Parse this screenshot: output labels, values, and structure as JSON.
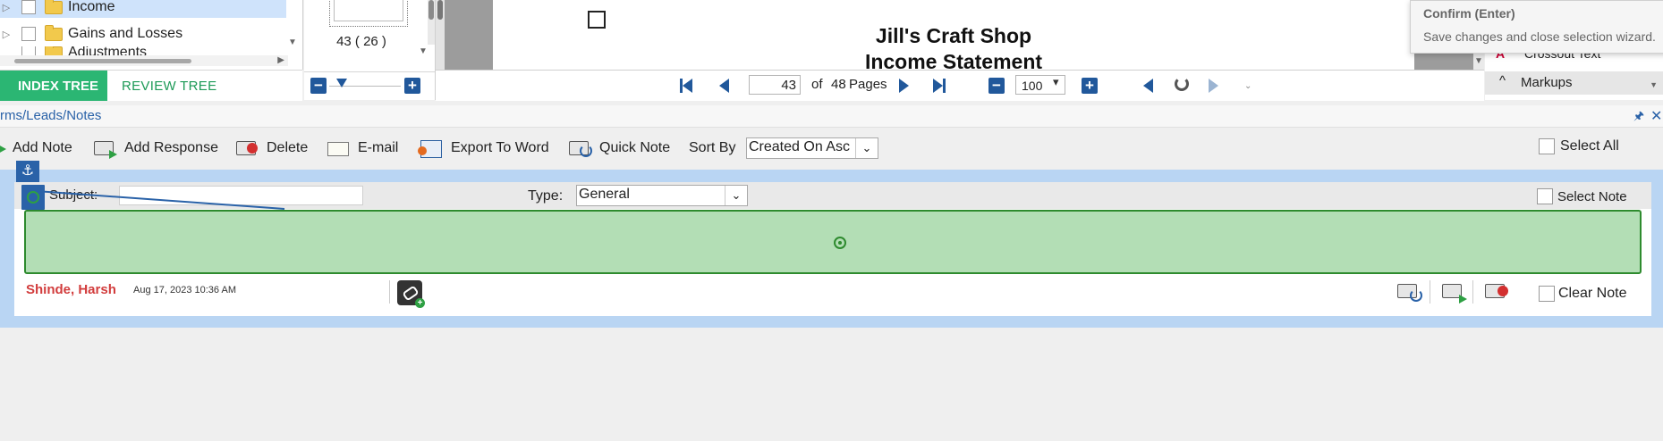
{
  "tree": {
    "items": [
      {
        "label": "Income"
      },
      {
        "label": "Gains and Losses"
      },
      {
        "label": "Adjustments"
      }
    ],
    "tabs": {
      "index": "INDEX TREE",
      "review": "REVIEW TREE"
    }
  },
  "thumbnails": {
    "label": "43 ( 26 )"
  },
  "document": {
    "title_line1": "Jill's Craft Shop",
    "title_line2": "Income Statement"
  },
  "pager": {
    "current_page": "43",
    "of_label": "of",
    "total_pages": "48",
    "pages_label": "Pages",
    "zoom": "100"
  },
  "tooltip": {
    "title": "Confirm (Enter)",
    "text": "Save changes and close selection wizard."
  },
  "right_panel": {
    "crossout_label": "Crossout Text",
    "markups_label": "Markups"
  },
  "notes": {
    "breadcrumb": "rms/Leads/Notes",
    "toolbar": {
      "add_note": "Add Note",
      "add_response": "Add Response",
      "delete": "Delete",
      "email": "E-mail",
      "export_word": "Export To Word",
      "quick_note": "Quick Note",
      "sort_by": "Sort By",
      "sort_value": "Created On Asc",
      "select_all": "Select All"
    },
    "card": {
      "subject_label": "Subject:",
      "subject_value": "",
      "type_label": "Type:",
      "type_value": "General",
      "select_note": "Select Note",
      "author": "Shinde, Harsh",
      "date": "Aug 17, 2023 10:36 AM",
      "clear_note": "Clear Note"
    }
  },
  "colors": {
    "accent_blue": "#2a62a8",
    "index_tab_green": "#2bb673",
    "note_body_green": "#b3deb5",
    "author_red": "#d23c3c",
    "notes_area_blue": "#b9d5f3"
  }
}
